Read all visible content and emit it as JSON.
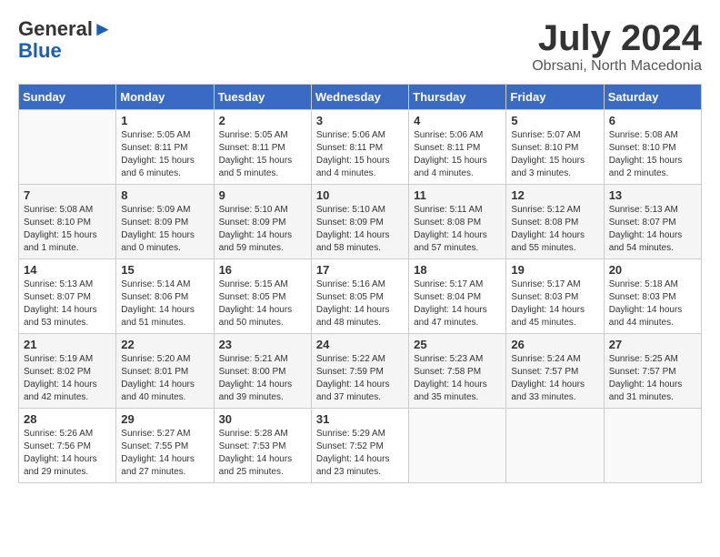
{
  "header": {
    "logo_line1": "General",
    "logo_line2": "Blue",
    "month_title": "July 2024",
    "location": "Obrsani, North Macedonia"
  },
  "days_of_week": [
    "Sunday",
    "Monday",
    "Tuesday",
    "Wednesday",
    "Thursday",
    "Friday",
    "Saturday"
  ],
  "weeks": [
    [
      {
        "day": "",
        "info": ""
      },
      {
        "day": "1",
        "info": "Sunrise: 5:05 AM\nSunset: 8:11 PM\nDaylight: 15 hours\nand 6 minutes."
      },
      {
        "day": "2",
        "info": "Sunrise: 5:05 AM\nSunset: 8:11 PM\nDaylight: 15 hours\nand 5 minutes."
      },
      {
        "day": "3",
        "info": "Sunrise: 5:06 AM\nSunset: 8:11 PM\nDaylight: 15 hours\nand 4 minutes."
      },
      {
        "day": "4",
        "info": "Sunrise: 5:06 AM\nSunset: 8:11 PM\nDaylight: 15 hours\nand 4 minutes."
      },
      {
        "day": "5",
        "info": "Sunrise: 5:07 AM\nSunset: 8:10 PM\nDaylight: 15 hours\nand 3 minutes."
      },
      {
        "day": "6",
        "info": "Sunrise: 5:08 AM\nSunset: 8:10 PM\nDaylight: 15 hours\nand 2 minutes."
      }
    ],
    [
      {
        "day": "7",
        "info": "Sunrise: 5:08 AM\nSunset: 8:10 PM\nDaylight: 15 hours\nand 1 minute."
      },
      {
        "day": "8",
        "info": "Sunrise: 5:09 AM\nSunset: 8:09 PM\nDaylight: 15 hours\nand 0 minutes."
      },
      {
        "day": "9",
        "info": "Sunrise: 5:10 AM\nSunset: 8:09 PM\nDaylight: 14 hours\nand 59 minutes."
      },
      {
        "day": "10",
        "info": "Sunrise: 5:10 AM\nSunset: 8:09 PM\nDaylight: 14 hours\nand 58 minutes."
      },
      {
        "day": "11",
        "info": "Sunrise: 5:11 AM\nSunset: 8:08 PM\nDaylight: 14 hours\nand 57 minutes."
      },
      {
        "day": "12",
        "info": "Sunrise: 5:12 AM\nSunset: 8:08 PM\nDaylight: 14 hours\nand 55 minutes."
      },
      {
        "day": "13",
        "info": "Sunrise: 5:13 AM\nSunset: 8:07 PM\nDaylight: 14 hours\nand 54 minutes."
      }
    ],
    [
      {
        "day": "14",
        "info": "Sunrise: 5:13 AM\nSunset: 8:07 PM\nDaylight: 14 hours\nand 53 minutes."
      },
      {
        "day": "15",
        "info": "Sunrise: 5:14 AM\nSunset: 8:06 PM\nDaylight: 14 hours\nand 51 minutes."
      },
      {
        "day": "16",
        "info": "Sunrise: 5:15 AM\nSunset: 8:05 PM\nDaylight: 14 hours\nand 50 minutes."
      },
      {
        "day": "17",
        "info": "Sunrise: 5:16 AM\nSunset: 8:05 PM\nDaylight: 14 hours\nand 48 minutes."
      },
      {
        "day": "18",
        "info": "Sunrise: 5:17 AM\nSunset: 8:04 PM\nDaylight: 14 hours\nand 47 minutes."
      },
      {
        "day": "19",
        "info": "Sunrise: 5:17 AM\nSunset: 8:03 PM\nDaylight: 14 hours\nand 45 minutes."
      },
      {
        "day": "20",
        "info": "Sunrise: 5:18 AM\nSunset: 8:03 PM\nDaylight: 14 hours\nand 44 minutes."
      }
    ],
    [
      {
        "day": "21",
        "info": "Sunrise: 5:19 AM\nSunset: 8:02 PM\nDaylight: 14 hours\nand 42 minutes."
      },
      {
        "day": "22",
        "info": "Sunrise: 5:20 AM\nSunset: 8:01 PM\nDaylight: 14 hours\nand 40 minutes."
      },
      {
        "day": "23",
        "info": "Sunrise: 5:21 AM\nSunset: 8:00 PM\nDaylight: 14 hours\nand 39 minutes."
      },
      {
        "day": "24",
        "info": "Sunrise: 5:22 AM\nSunset: 7:59 PM\nDaylight: 14 hours\nand 37 minutes."
      },
      {
        "day": "25",
        "info": "Sunrise: 5:23 AM\nSunset: 7:58 PM\nDaylight: 14 hours\nand 35 minutes."
      },
      {
        "day": "26",
        "info": "Sunrise: 5:24 AM\nSunset: 7:57 PM\nDaylight: 14 hours\nand 33 minutes."
      },
      {
        "day": "27",
        "info": "Sunrise: 5:25 AM\nSunset: 7:57 PM\nDaylight: 14 hours\nand 31 minutes."
      }
    ],
    [
      {
        "day": "28",
        "info": "Sunrise: 5:26 AM\nSunset: 7:56 PM\nDaylight: 14 hours\nand 29 minutes."
      },
      {
        "day": "29",
        "info": "Sunrise: 5:27 AM\nSunset: 7:55 PM\nDaylight: 14 hours\nand 27 minutes."
      },
      {
        "day": "30",
        "info": "Sunrise: 5:28 AM\nSunset: 7:53 PM\nDaylight: 14 hours\nand 25 minutes."
      },
      {
        "day": "31",
        "info": "Sunrise: 5:29 AM\nSunset: 7:52 PM\nDaylight: 14 hours\nand 23 minutes."
      },
      {
        "day": "",
        "info": ""
      },
      {
        "day": "",
        "info": ""
      },
      {
        "day": "",
        "info": ""
      }
    ]
  ]
}
